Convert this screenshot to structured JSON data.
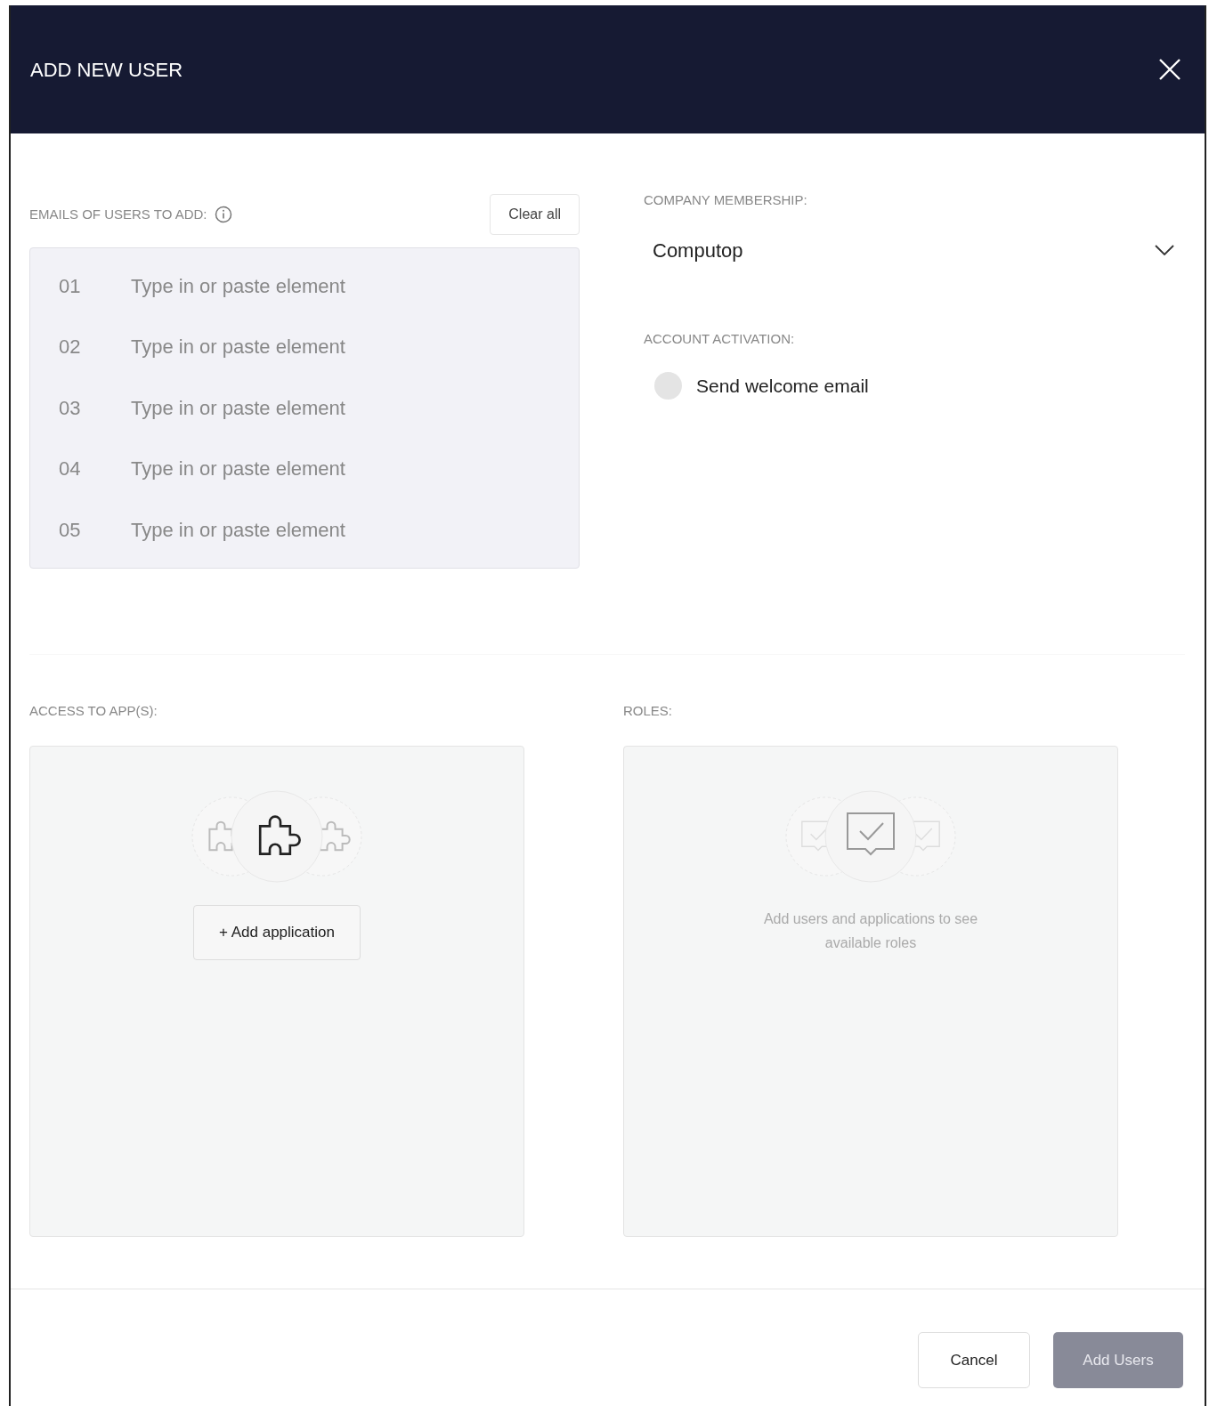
{
  "window": {
    "title": "ADD NEW USER"
  },
  "emails": {
    "label": "EMAILS OF USERS TO ADD:",
    "clear_button": "Clear all",
    "rows": [
      {
        "number": "01",
        "placeholder": "Type in or paste element"
      },
      {
        "number": "02",
        "placeholder": "Type in or paste element"
      },
      {
        "number": "03",
        "placeholder": "Type in or paste element"
      },
      {
        "number": "04",
        "placeholder": "Type in or paste element"
      },
      {
        "number": "05",
        "placeholder": "Type in or paste element"
      }
    ]
  },
  "company": {
    "label": "COMPANY MEMBERSHIP:",
    "value": "Computop"
  },
  "activation": {
    "label": "ACCOUNT ACTIVATION:",
    "option": "Send welcome email",
    "checked": false
  },
  "apps": {
    "label": "ACCESS TO APP(S):",
    "button": "+ Add application"
  },
  "roles": {
    "label": "ROLES:",
    "empty_text": "Add users and applications to see available roles"
  },
  "footer": {
    "cancel": "Cancel",
    "submit": "Add Users",
    "submit_disabled": true
  }
}
